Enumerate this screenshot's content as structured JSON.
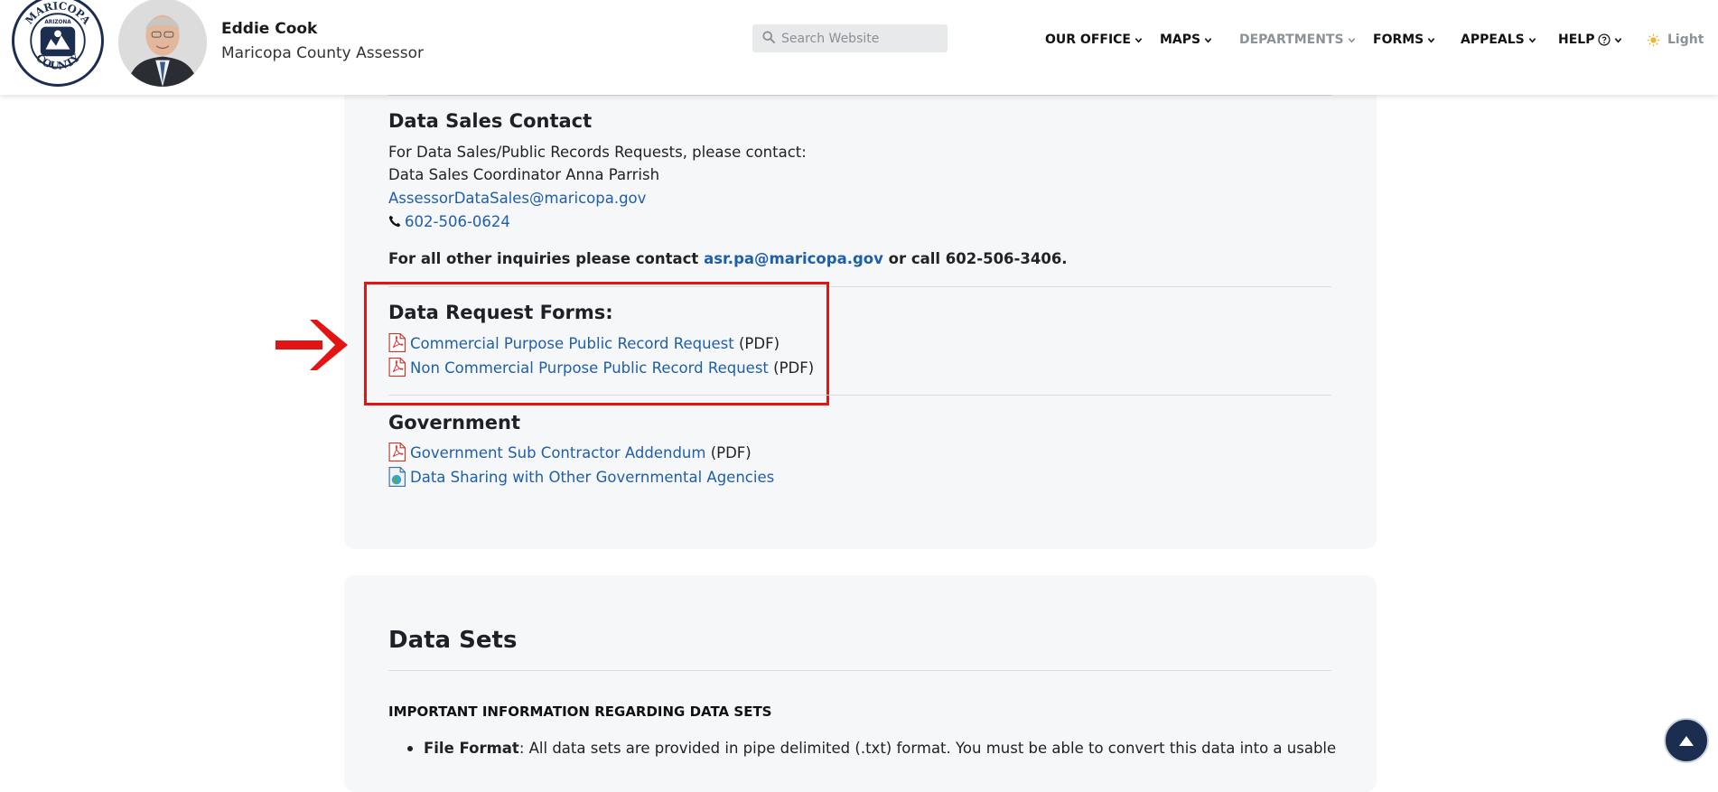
{
  "header": {
    "seal_text_top": "MARICOPA",
    "seal_text_bottom": "COUNTY",
    "seal_text_center": "ARIZONA",
    "name": "Eddie Cook",
    "subtitle": "Maricopa County Assessor",
    "search_placeholder": "Search Website",
    "nav": [
      {
        "label": "OUR OFFICE",
        "muted": false
      },
      {
        "label": "MAPS",
        "muted": false
      },
      {
        "label": "DEPARTMENTS",
        "muted": true
      },
      {
        "label": "FORMS",
        "muted": false
      },
      {
        "label": "APPEALS",
        "muted": false
      },
      {
        "label": "HELP",
        "muted": false
      }
    ],
    "theme_label": "Light"
  },
  "data_sales": {
    "heading": "Data Sales Contact",
    "line1": "For Data Sales/Public Records Requests, please contact:",
    "line2": "Data Sales Coordinator Anna Parrish",
    "email": "AssessorDataSales@maricopa.gov",
    "phone": "602-506-0624",
    "other_prefix": "For all other inquiries please contact ",
    "other_email": "asr.pa@maricopa.gov",
    "other_suffix": " or call 602-506-3406."
  },
  "request_forms": {
    "heading": "Data Request Forms:",
    "items": [
      {
        "label": "Commercial Purpose Public Record Request",
        "suffix": " (PDF)"
      },
      {
        "label": "Non Commercial Purpose Public Record Request",
        "suffix": " (PDF)"
      }
    ]
  },
  "government": {
    "heading": "Government",
    "items": [
      {
        "label": "Government Sub Contractor Addendum",
        "suffix": " (PDF)",
        "icon": "pdf-icon"
      },
      {
        "label": "Data Sharing with Other Governmental Agencies",
        "suffix": "",
        "icon": "web-page-icon"
      }
    ]
  },
  "data_sets": {
    "heading": "Data Sets",
    "important": "IMPORTANT INFORMATION REGARDING DATA SETS",
    "bullet_label": "File Format",
    "bullet_text": ": All data sets are provided in pipe delimited (.txt) format. You must be able to convert this data into a usable"
  },
  "colors": {
    "link": "#1f5fa8",
    "annotation_red": "#e21414",
    "navy": "#1c2e4f"
  }
}
